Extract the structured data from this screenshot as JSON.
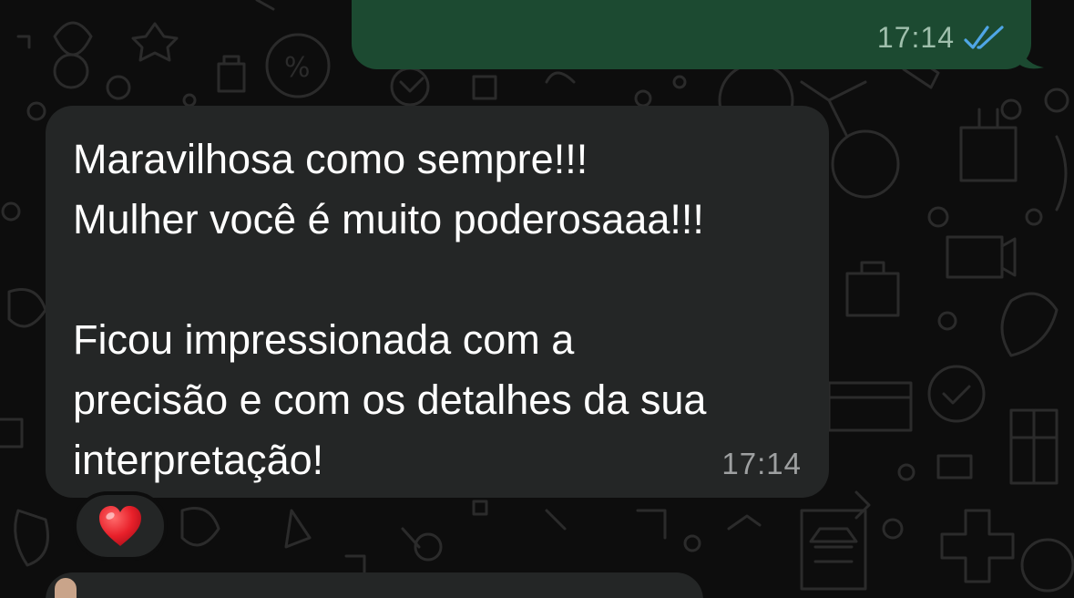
{
  "outgoing_message": {
    "time": "17:14",
    "status_icon": "double-check-read-icon",
    "status_color": "#4fa6e6",
    "bubble_color": "#1c4a31"
  },
  "incoming_message": {
    "lines": [
      "Maravilhosa como sempre!!!",
      "Mulher você é muito poderosaaa!!!",
      "",
      "Ficou impressionada com a",
      "precisão e com os detalhes da sua",
      "interpretação!"
    ],
    "time": "17:14",
    "bubble_color": "#242626"
  },
  "reaction": {
    "emoji": "❤️",
    "icon": "red-heart-icon"
  },
  "wallpaper": {
    "background_color": "#0d0d0d",
    "doodle_color": "#2a2a2a"
  }
}
